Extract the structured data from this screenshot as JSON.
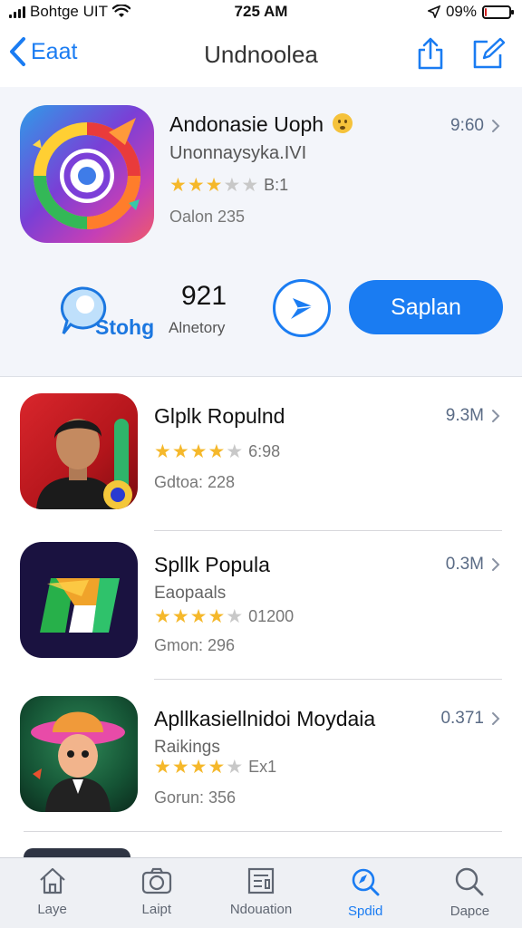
{
  "status_bar": {
    "carrier": "Bohtge UIT",
    "time": "725 AM",
    "battery": "09%",
    "battery_level": 0.09
  },
  "nav": {
    "back_label": "Eaat",
    "title": "Undnoolea"
  },
  "featured": {
    "title": "Andonasie Uoph",
    "developer": "Unonnaysyka.IVI",
    "rating_value": 3.5,
    "rating_text": "B:1",
    "size": "Oalon 235",
    "price": "9:60",
    "store_label": "Stohg",
    "count": "921",
    "count_label": "Alnetory",
    "primary_button": "Saplan"
  },
  "apps": [
    {
      "title": "Glplk Ropulnd",
      "subtitle": "",
      "rating_value": 4.5,
      "rating_text": "6:98",
      "size": "Gdtoa: 228",
      "price": "9.3M"
    },
    {
      "title": "Spllk Popula",
      "subtitle": "Eaopaals",
      "rating_value": 4.5,
      "rating_text": "01200",
      "size": "Gmon: 296",
      "price": "0.3M"
    },
    {
      "title": "Apllkasiellnidoi Moydaia",
      "subtitle": "Raikings",
      "rating_value": 4.5,
      "rating_text": "Ex1",
      "size": "Gorun: 356",
      "price": "0.371"
    }
  ],
  "tabs": [
    {
      "label": "Laye",
      "icon": "home-icon"
    },
    {
      "label": "Laipt",
      "icon": "camera-icon"
    },
    {
      "label": "Ndouation",
      "icon": "news-icon"
    },
    {
      "label": "Spdid",
      "icon": "search-active-icon"
    },
    {
      "label": "Dapce",
      "icon": "search-icon"
    }
  ],
  "colors": {
    "accent": "#1a7cf2",
    "star": "#f5b82b",
    "battery_low": "#d62020"
  }
}
